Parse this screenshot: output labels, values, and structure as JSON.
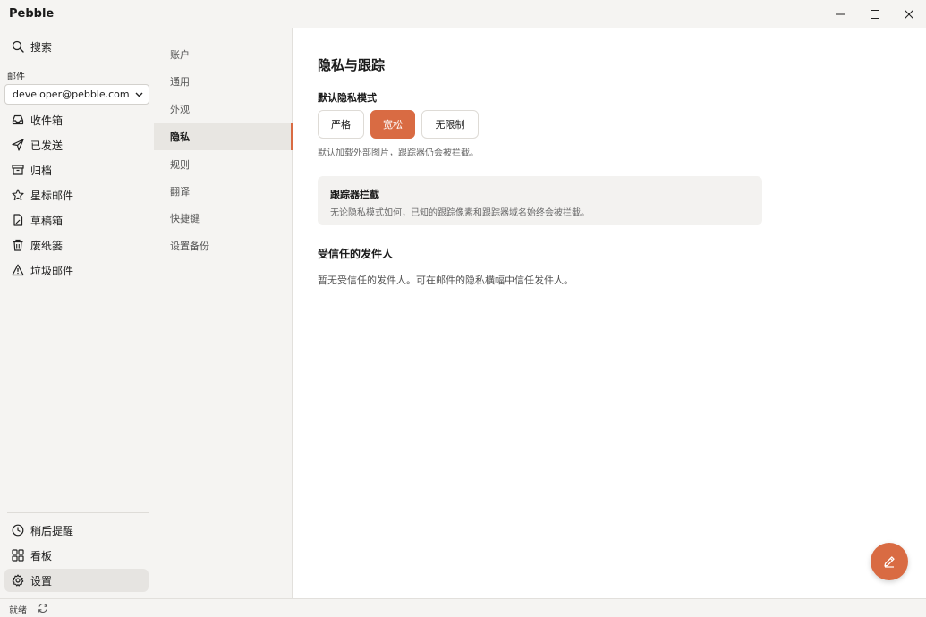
{
  "app": {
    "title": "Pebble"
  },
  "sidebar": {
    "search_label": "搜索",
    "mail_section_label": "邮件",
    "account": "developer@pebble.com",
    "folders": [
      {
        "label": "收件箱",
        "icon": "inbox-icon"
      },
      {
        "label": "已发送",
        "icon": "send-icon"
      },
      {
        "label": "归档",
        "icon": "archive-icon"
      },
      {
        "label": "星标邮件",
        "icon": "star-icon"
      },
      {
        "label": "草稿箱",
        "icon": "draft-icon"
      },
      {
        "label": "废纸篓",
        "icon": "trash-icon"
      },
      {
        "label": "垃圾邮件",
        "icon": "spam-icon"
      }
    ],
    "bottom": [
      {
        "label": "稍后提醒",
        "icon": "clock-icon"
      },
      {
        "label": "看板",
        "icon": "board-icon"
      },
      {
        "label": "设置",
        "icon": "gear-icon",
        "active": true
      }
    ]
  },
  "settings_nav": {
    "items": [
      "账户",
      "通用",
      "外观",
      "隐私",
      "规则",
      "翻译",
      "快捷键",
      "设置备份"
    ],
    "active_index": 3
  },
  "privacy": {
    "title": "隐私与跟踪",
    "mode_heading": "默认隐私模式",
    "modes": [
      "严格",
      "宽松",
      "无限制"
    ],
    "selected_mode": "宽松",
    "mode_help": "默认加载外部图片，跟踪器仍会被拦截。",
    "tracker_card": {
      "title": "跟踪器拦截",
      "body": "无论隐私模式如何，已知的跟踪像素和跟踪器域名始终会被拦截。"
    },
    "trusted_heading": "受信任的发件人",
    "trusted_empty": "暂无受信任的发件人。可在邮件的隐私横幅中信任发件人。"
  },
  "statusbar": {
    "status": "就绪"
  },
  "colors": {
    "accent": "#d96b43"
  }
}
